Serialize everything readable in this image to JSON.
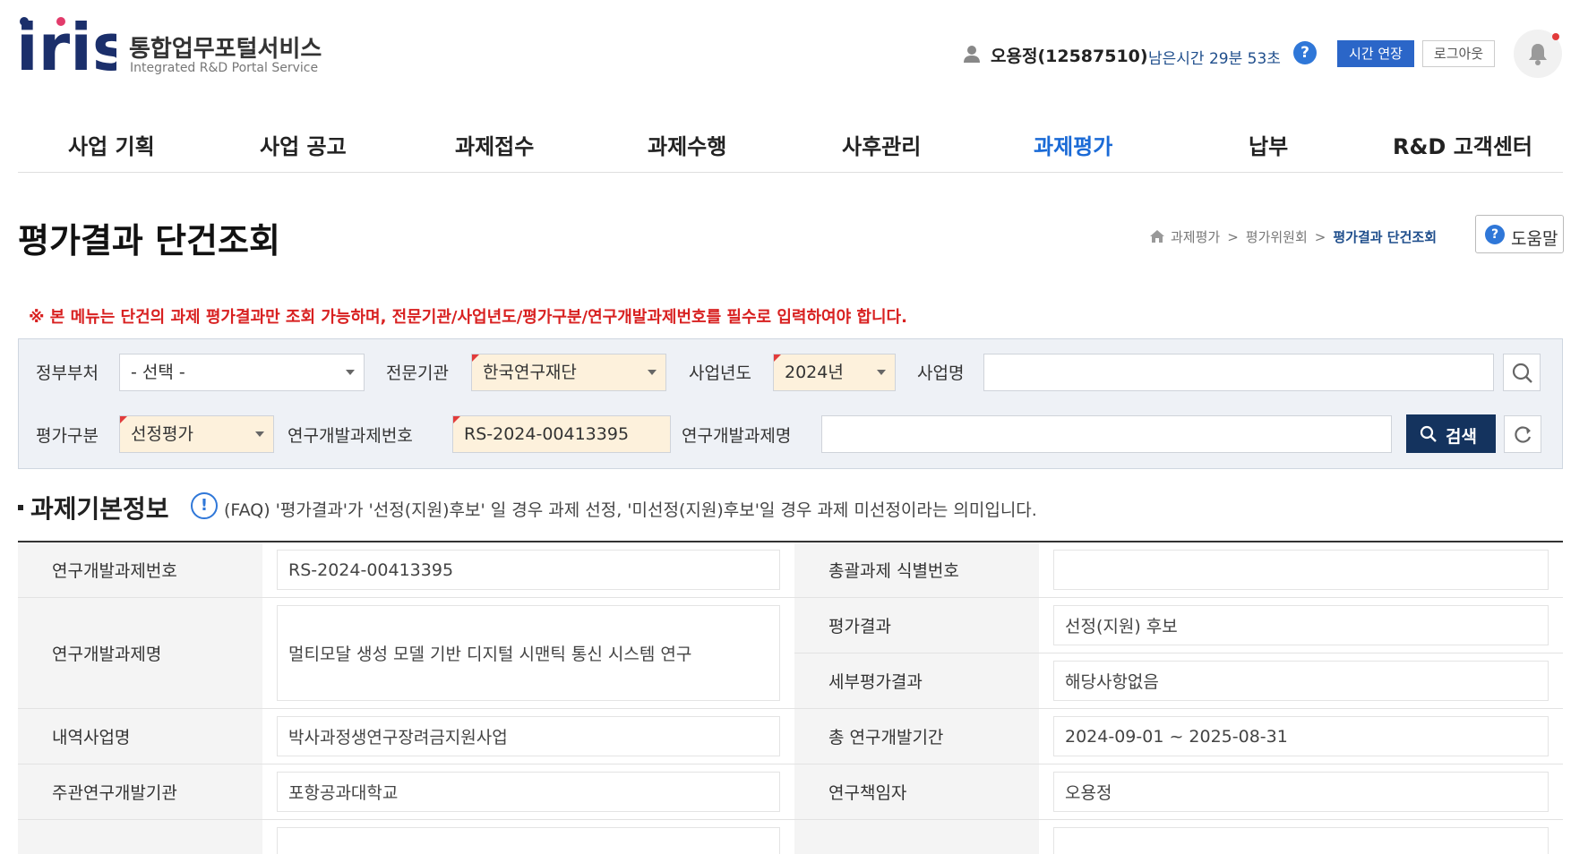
{
  "header": {
    "logo_text": "iris",
    "title_ko": "통합업무포털서비스",
    "title_en": "Integrated R&D Portal Service",
    "user_name": "오용정(12587510)",
    "remain_time": "남은시간 29분 53초",
    "help_symbol": "?",
    "extend_label": "시간 연장",
    "logout_label": "로그아웃"
  },
  "nav": {
    "items": [
      "사업 기획",
      "사업 공고",
      "과제접수",
      "과제수행",
      "사후관리",
      "과제평가",
      "납부",
      "R&D 고객센터"
    ],
    "active": "과제평가"
  },
  "page": {
    "title": "평가결과 단건조회",
    "breadcrumb": [
      "과제평가",
      "평가위원회",
      "평가결과 단건조회"
    ],
    "breadcrumb_sep": ">",
    "help_label": "도움말",
    "help_symbol": "?"
  },
  "notice": "※ 본 메뉴는 단건의 과제 평가결과만 조회 가능하며, 전문기관/사업년도/평가구분/연구개발과제번호를 필수로 입력하여야 합니다.",
  "search": {
    "ministry_label": "정부부처",
    "ministry_value": "- 선택 -",
    "agency_label": "전문기관",
    "agency_value": "한국연구재단",
    "year_label": "사업년도",
    "year_value": "2024년",
    "project_label": "사업명",
    "project_value": "",
    "eval_label": "평가구분",
    "eval_value": "선정평가",
    "rnd_no_label": "연구개발과제번호",
    "rnd_no_value": "RS-2024-00413395",
    "rnd_name_label": "연구개발과제명",
    "rnd_name_value": "",
    "search_button": "검색"
  },
  "section": {
    "title": "과제기본정보",
    "info_symbol": "!",
    "faq": "(FAQ) '평가결과'가 '선정(지원)후보' 일 경우 과제 선정, '미선정(지원)후보'일 경우 과제 미선정이라는 의미입니다."
  },
  "basic_info": {
    "rnd_no_label": "연구개발과제번호",
    "rnd_no": "RS-2024-00413395",
    "umbrella_id_label": "총괄과제 식별번호",
    "umbrella_id": "",
    "rnd_name_label": "연구개발과제명",
    "rnd_name": "멀티모달 생성 모델 기반 디지털 시맨틱 통신 시스템 연구",
    "eval_result_label": "평가결과",
    "eval_result": "선정(지원) 후보",
    "detail_result_label": "세부평가결과",
    "detail_result": "해당사항없음",
    "sub_program_label": "내역사업명",
    "sub_program": "박사과정생연구장려금지원사업",
    "period_label": "총 연구개발기간",
    "period": "2024-09-01 ~ 2025-08-31",
    "host_org_label": "주관연구개발기관",
    "host_org": "포항공과대학교",
    "pi_label": "연구책임자",
    "pi": "오용정"
  },
  "colors": {
    "accent": "#1a6ad6",
    "search_button": "#14335e",
    "notice": "#d82020",
    "required_bg": "#fdf1dc"
  }
}
